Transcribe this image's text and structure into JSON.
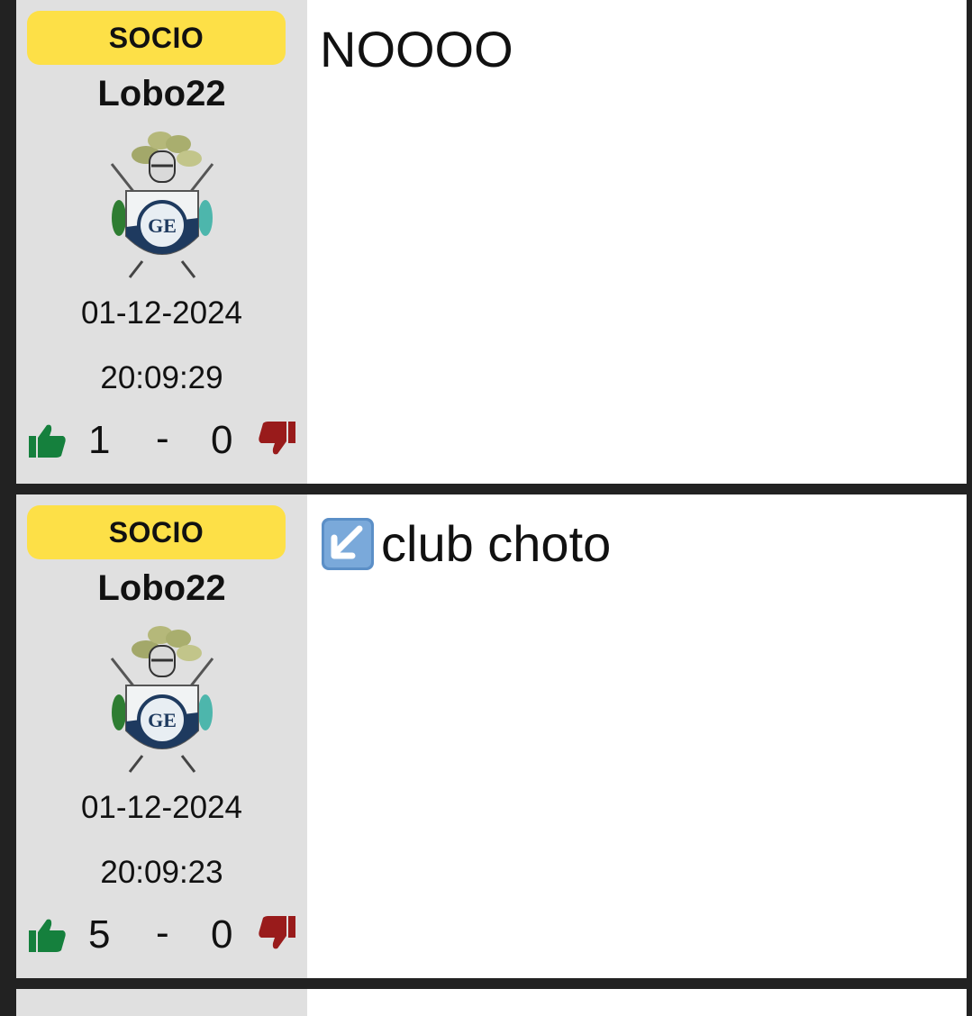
{
  "posts": [
    {
      "badge": "SOCIO",
      "username": "Lobo22",
      "date": "01-12-2024",
      "time": "20:09:29",
      "likes": "1",
      "separator": "-",
      "dislikes": "0",
      "message": "NOOOO",
      "message_icon": ""
    },
    {
      "badge": "SOCIO",
      "username": "Lobo22",
      "date": "01-12-2024",
      "time": "20:09:23",
      "likes": "5",
      "separator": "-",
      "dislikes": "0",
      "message": "club choto",
      "message_icon": "arrow-down-left-icon"
    }
  ],
  "colors": {
    "badge": "#fde047",
    "sidebar": "#e0e0e0",
    "like": "#15803d",
    "dislike": "#991b1b",
    "page_bg": "#222222"
  }
}
